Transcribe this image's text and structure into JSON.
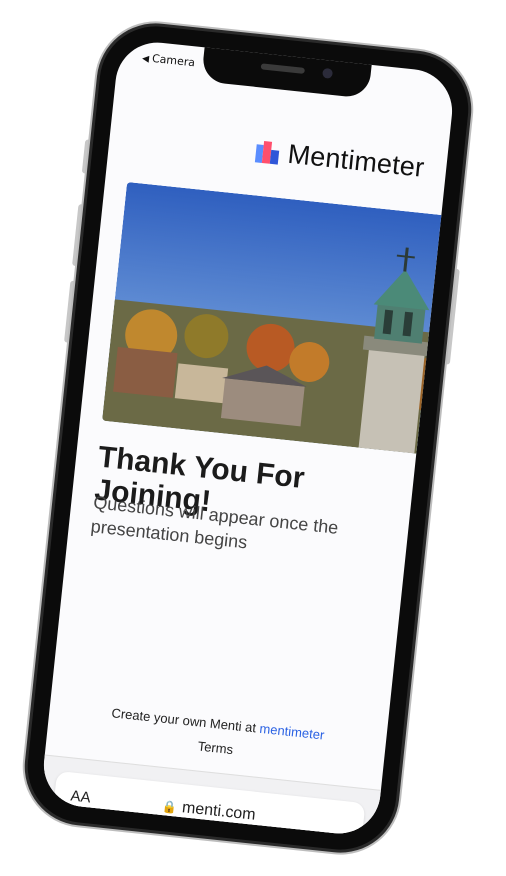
{
  "status_bar": {
    "back_label": "Camera"
  },
  "brand": {
    "name": "Mentimeter"
  },
  "content": {
    "heading": "Thank You For Joining!",
    "subtext": "Questions will appear once the presentation begins"
  },
  "footer": {
    "prefix": "Create your own Menti at ",
    "link": "mentimeter",
    "terms": "Terms"
  },
  "browser": {
    "text_size_label": "AA",
    "url": "menti.com"
  },
  "colors": {
    "link": "#2b62e3",
    "logo": [
      "#5a8dff",
      "#ff4f6d",
      "#2f56d8"
    ]
  }
}
